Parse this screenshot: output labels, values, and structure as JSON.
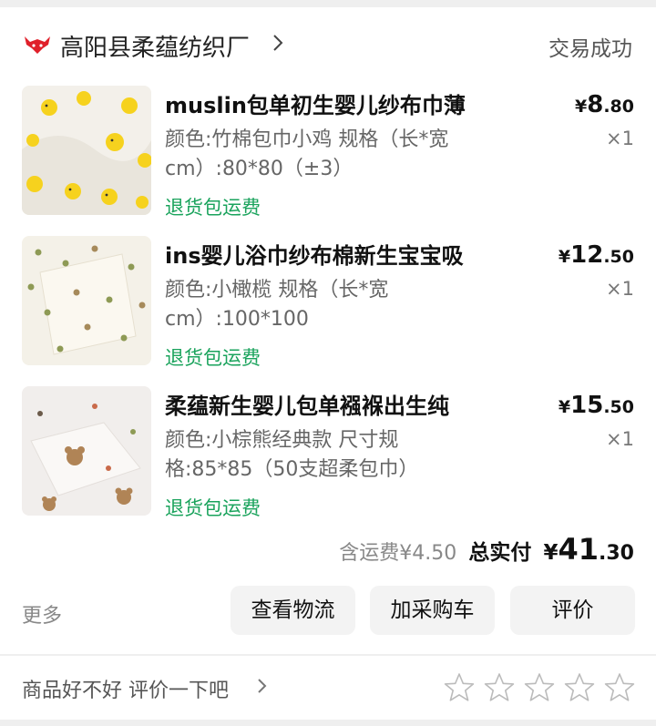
{
  "shop": {
    "name": "高阳县柔蕴纺织厂",
    "status": "交易成功"
  },
  "items": [
    {
      "title": "muslin包单初生婴儿纱布巾薄",
      "spec": "颜色:竹棉包巾小鸡 规格（长*宽cm）:80*80（±3）",
      "tag": "退货包运费",
      "price_yen": "¥",
      "price_int": "8",
      "price_dec": ".80",
      "qty": "×1",
      "image": "yellow-chick-pattern-swaddle"
    },
    {
      "title": "ins婴儿浴巾纱布棉新生宝宝吸",
      "spec": "颜色:小橄榄 规格（长*宽cm）:100*100",
      "tag": "退货包运费",
      "price_yen": "¥",
      "price_int": "12",
      "price_dec": ".50",
      "qty": "×1",
      "image": "olive-dot-pattern-towel"
    },
    {
      "title": "柔蕴新生婴儿包单襁褓出生纯",
      "spec": "颜色:小棕熊经典款 尺寸规格:85*85（50支超柔包巾）",
      "tag": "退货包运费",
      "price_yen": "¥",
      "price_int": "15",
      "price_dec": ".50",
      "qty": "×1",
      "image": "brown-bear-pattern-swaddle"
    }
  ],
  "summary": {
    "shipping": "含运费¥4.50",
    "total_label": "总实付",
    "total_yen": "¥",
    "total_int": "41",
    "total_dec": ".30"
  },
  "actions": {
    "more": "更多",
    "logistics": "查看物流",
    "add_cart": "加采购车",
    "review": "评价"
  },
  "review_prompt": {
    "text": "商品好不好 评价一下吧",
    "star_count": 5
  },
  "colors": {
    "accent_green": "#1aa35c",
    "logo_red": "#e0202a",
    "star_outline": "#bbbbbb"
  }
}
